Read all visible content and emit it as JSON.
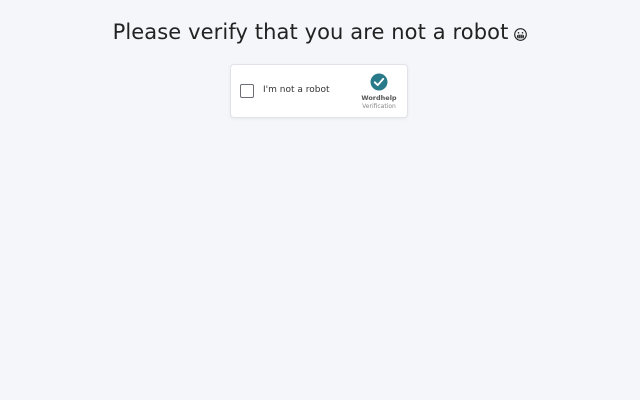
{
  "page": {
    "title": "Please verify that you are not a robot",
    "title_emoji_icon": "grimacing-face-icon"
  },
  "captcha": {
    "checkbox_label": "I'm not a robot",
    "checked": false,
    "brand_icon": "check-circle-icon",
    "brand_name": "Wordhelp",
    "brand_subtitle": "Verification",
    "brand_color": "#2a7b8a"
  },
  "colors": {
    "background": "#f5f6fa",
    "card_background": "#ffffff",
    "text": "#222222"
  }
}
